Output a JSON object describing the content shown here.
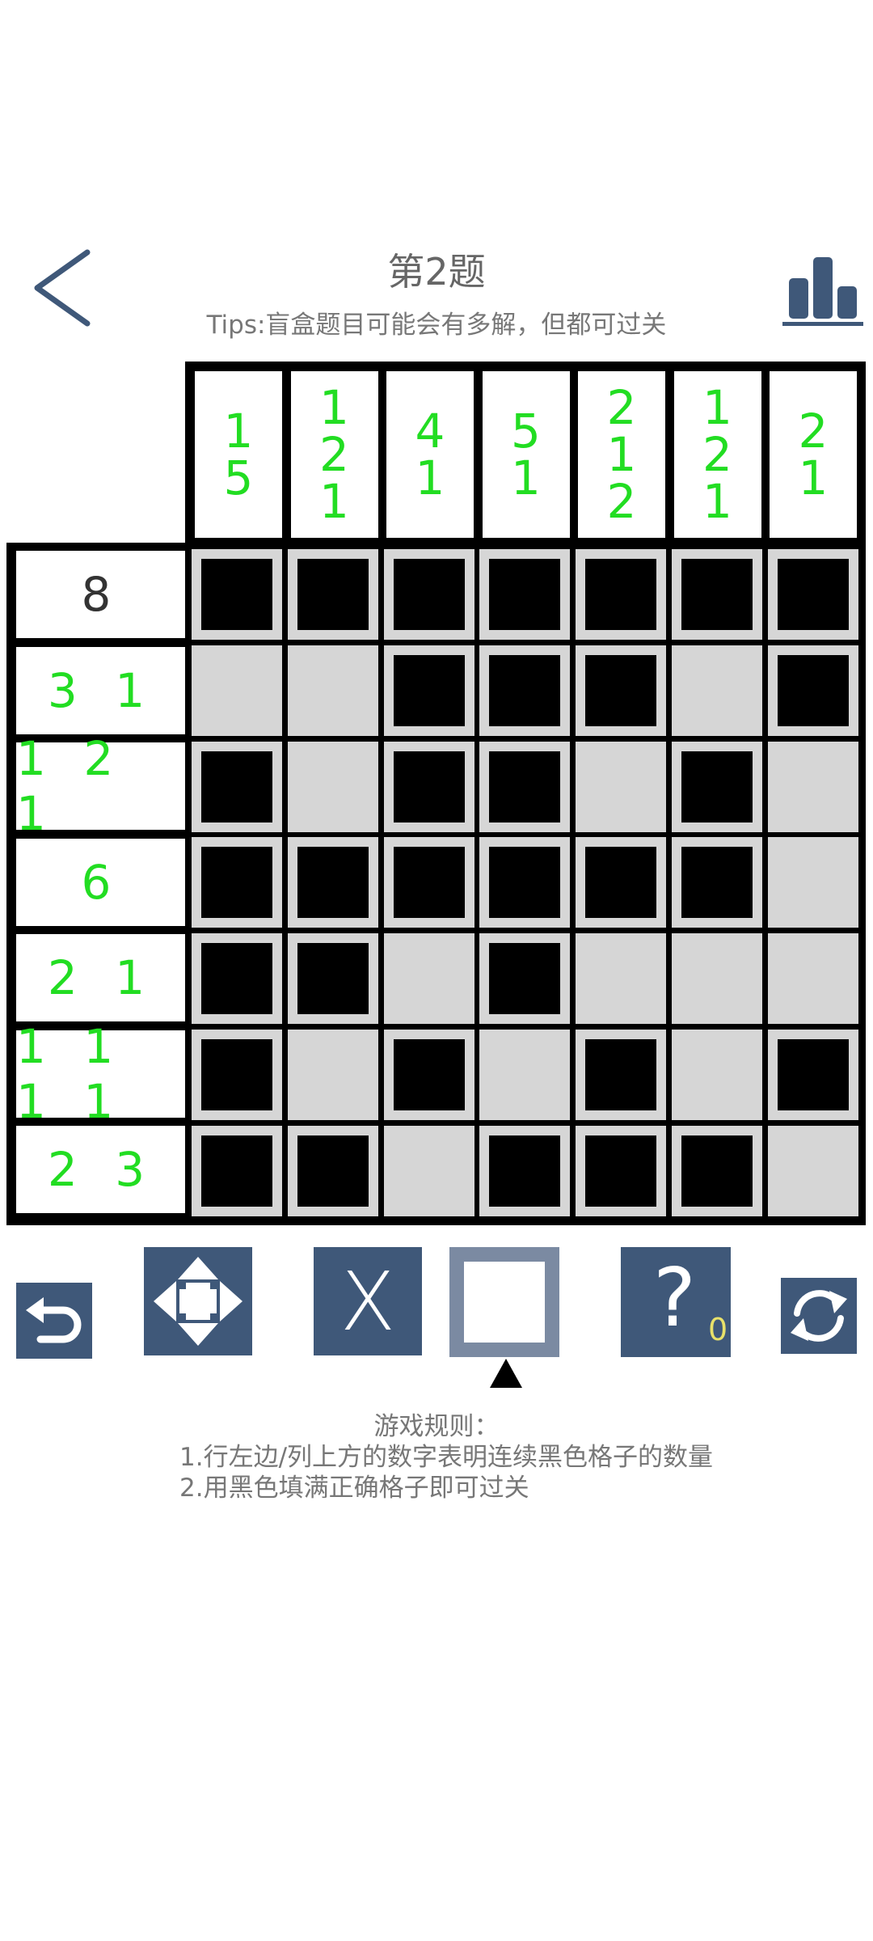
{
  "header": {
    "title": "第2题",
    "tips": "Tips:盲盒题目可能会有多解，但都可过关",
    "icons": {
      "back": "chevron-left-icon",
      "stats": "bar-chart-icon"
    },
    "accent_color": "#3f5879"
  },
  "puzzle": {
    "size": 7,
    "column_clues": [
      [
        "1",
        "5"
      ],
      [
        "1",
        "2",
        "1"
      ],
      [
        "4",
        "1"
      ],
      [
        "5",
        "1"
      ],
      [
        "2",
        "1",
        "2"
      ],
      [
        "1",
        "2",
        "1"
      ],
      [
        "2",
        "1"
      ]
    ],
    "row_clues": [
      "8",
      "3 1",
      "1 2 1",
      "6",
      "2 1",
      "1 1 1 1",
      "2 3"
    ],
    "row_clue_done": [
      true,
      false,
      false,
      false,
      false,
      false,
      false
    ],
    "grid": [
      [
        1,
        1,
        1,
        1,
        1,
        1,
        1
      ],
      [
        0,
        0,
        1,
        1,
        1,
        0,
        1
      ],
      [
        1,
        0,
        1,
        1,
        0,
        1,
        0
      ],
      [
        1,
        1,
        1,
        1,
        1,
        1,
        0
      ],
      [
        1,
        1,
        0,
        1,
        0,
        0,
        0
      ],
      [
        1,
        0,
        1,
        0,
        1,
        0,
        1
      ],
      [
        1,
        1,
        0,
        1,
        1,
        1,
        0
      ]
    ],
    "clue_color": "#22dd22",
    "done_clue_color": "#333333"
  },
  "toolbar": {
    "undo": "undo-icon",
    "move": "move-arrows-icon",
    "cross_label": "X",
    "fill": "square-fill-icon",
    "hint_label": "?",
    "hint_count": "0",
    "restart": "refresh-icon",
    "selected_tool": "fill"
  },
  "rules": {
    "title": "游戏规则：",
    "line1": "1.行左边/列上方的数字表明连续黑色格子的数量",
    "line2": "2.用黑色填满正确格子即可过关"
  }
}
